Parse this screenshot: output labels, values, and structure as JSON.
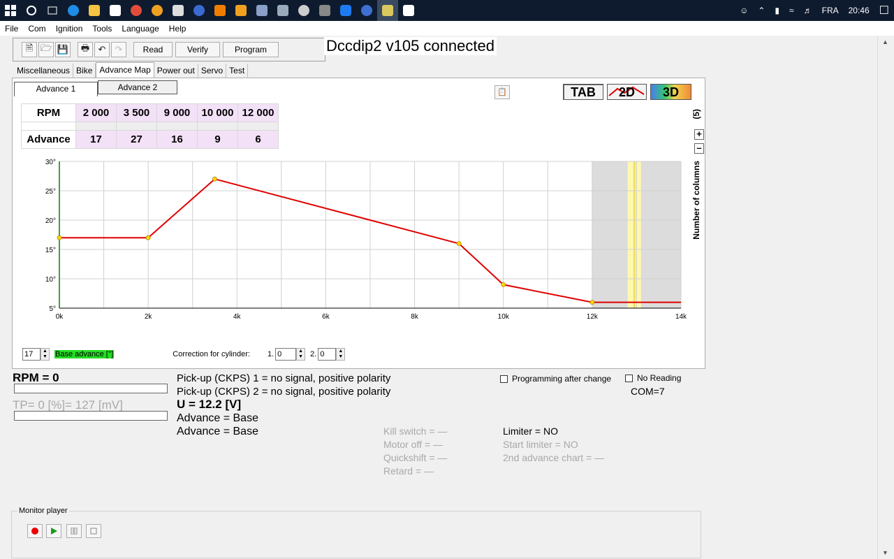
{
  "taskbar": {
    "lang": "FRA",
    "time": "20:46"
  },
  "menu": [
    "File",
    "Com",
    "Ignition",
    "Tools",
    "Language",
    "Help"
  ],
  "toolbar": {
    "read": "Read",
    "verify": "Verify",
    "program": "Program"
  },
  "status_title": "Dccdip2 v105 connected",
  "main_tabs": [
    "Miscellaneous",
    "Bike",
    "Advance Map",
    "Power out",
    "Servo",
    "Test"
  ],
  "sub_tabs": [
    "Advance 1",
    "Advance 2"
  ],
  "view_buttons": {
    "tab": "TAB",
    "d2": "2D",
    "d3": "3D"
  },
  "columns": {
    "count": "(5)",
    "plus": "+",
    "minus": "–",
    "label": "Number of columns"
  },
  "table": {
    "rpm_label": "RPM",
    "advance_label": "Advance",
    "rpm": [
      "2 000",
      "3 500",
      "9 000",
      "10 000",
      "12 000"
    ],
    "advance": [
      "17",
      "27",
      "16",
      "9",
      "6"
    ]
  },
  "chart_data": {
    "type": "line",
    "x_ticks": [
      "0k",
      "2k",
      "4k",
      "6k",
      "8k",
      "10k",
      "12k",
      "14k"
    ],
    "y_ticks": [
      "5°",
      "10°",
      "15°",
      "20°",
      "25°",
      "30°"
    ],
    "xlim": [
      0,
      14000
    ],
    "ylim": [
      5,
      30
    ],
    "points": [
      {
        "x": 0,
        "y": 17
      },
      {
        "x": 2000,
        "y": 17
      },
      {
        "x": 3500,
        "y": 27
      },
      {
        "x": 9000,
        "y": 16
      },
      {
        "x": 10000,
        "y": 9
      },
      {
        "x": 12000,
        "y": 6
      },
      {
        "x": 14000,
        "y": 6
      }
    ],
    "shaded_region_x": [
      12000,
      14000
    ],
    "highlight_band_x": [
      12800,
      13100
    ],
    "grid": true,
    "line_color": "#e00000",
    "marker_color": "#ffd700"
  },
  "base_advance": {
    "value": "17",
    "label": "Base advance [°]"
  },
  "correction": {
    "label": "Correction for cylinder:",
    "cyl1_label": "1.",
    "cyl1_value": "0",
    "cyl2_label": "2.",
    "cyl2_value": "0"
  },
  "status": {
    "rpm": "RPM = 0",
    "tp": "TP= 0 [%]= 127 [mV]",
    "pickup1": "Pick-up (CKPS) 1 = no signal, positive polarity",
    "pickup2": "Pick-up (CKPS) 2 = no signal, positive polarity",
    "voltage": "U = 12.2 [V]",
    "advance1": "Advance = Base",
    "advance2": "Advance = Base",
    "kill_switch": "Kill switch = —",
    "motor_off": "Motor off = —",
    "quickshift": "Quickshift = —",
    "retard": "Retard = —",
    "limiter": "Limiter = NO",
    "start_limiter": "Start limiter = NO",
    "second_chart": "2nd advance chart = —",
    "programming_after_change": "Programming after change",
    "no_reading": "No Reading",
    "com": "COM=7"
  },
  "monitor": {
    "title": "Monitor player"
  }
}
